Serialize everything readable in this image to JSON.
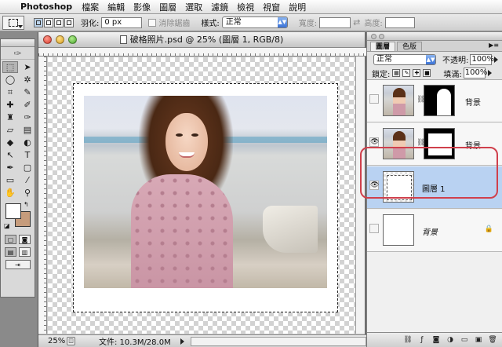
{
  "menubar": {
    "app_name": "Photoshop",
    "items": [
      "檔案",
      "編輯",
      "影像",
      "圖層",
      "選取",
      "濾鏡",
      "檢視",
      "視窗",
      "說明"
    ]
  },
  "options": {
    "feather_label": "羽化:",
    "feather_value": "0 px",
    "antialias_label": "消除鋸齒",
    "style_label": "樣式:",
    "style_value": "正常",
    "width_label": "寬度:",
    "height_label": "高度:",
    "width_value": "",
    "height_value": ""
  },
  "toolbox": {
    "tools": [
      {
        "name": "marquee-tool-icon",
        "glyph": "⬚"
      },
      {
        "name": "move-tool-icon",
        "glyph": "➤"
      },
      {
        "name": "lasso-tool-icon",
        "glyph": "◯"
      },
      {
        "name": "magic-wand-tool-icon",
        "glyph": "✲"
      },
      {
        "name": "crop-tool-icon",
        "glyph": "⌗"
      },
      {
        "name": "slice-tool-icon",
        "glyph": "✎"
      },
      {
        "name": "healing-brush-icon",
        "glyph": "✚"
      },
      {
        "name": "brush-tool-icon",
        "glyph": "✐"
      },
      {
        "name": "stamp-tool-icon",
        "glyph": "♜"
      },
      {
        "name": "history-brush-icon",
        "glyph": "✑"
      },
      {
        "name": "eraser-tool-icon",
        "glyph": "▱"
      },
      {
        "name": "gradient-tool-icon",
        "glyph": "▤"
      },
      {
        "name": "blur-tool-icon",
        "glyph": "◆"
      },
      {
        "name": "dodge-tool-icon",
        "glyph": "◐"
      },
      {
        "name": "path-selection-icon",
        "glyph": "↖"
      },
      {
        "name": "type-tool-icon",
        "glyph": "T"
      },
      {
        "name": "pen-tool-icon",
        "glyph": "✒"
      },
      {
        "name": "shape-tool-icon",
        "glyph": "▢"
      },
      {
        "name": "notes-tool-icon",
        "glyph": "▭"
      },
      {
        "name": "eyedropper-tool-icon",
        "glyph": "⁄"
      },
      {
        "name": "hand-tool-icon",
        "glyph": "✋"
      },
      {
        "name": "zoom-tool-icon",
        "glyph": "⚲"
      }
    ],
    "fg_color": "#ffffff",
    "bg_color": "#c69c7c"
  },
  "document": {
    "title": "破格照片.psd @ 25% (圖層 1, RGB/8)",
    "zoom": "25%",
    "file_info": "文件: 10.3M/28.0M"
  },
  "layers": {
    "tab_layers": "圖層",
    "tab_channels": "色版",
    "blend_mode": "正常",
    "opacity_label": "不透明:",
    "opacity_value": "100%",
    "lock_label": "鎖定:",
    "fill_label": "填滿:",
    "fill_value": "100%",
    "rows": [
      {
        "name": "背景",
        "visible": false
      },
      {
        "name": "背景",
        "visible": true
      },
      {
        "name": "圖層 1",
        "visible": true,
        "selected": true
      },
      {
        "name": "背景",
        "visible": false,
        "locked": true
      }
    ]
  },
  "colors": {
    "highlight": "#d0404c",
    "selected_layer": "#b9d2f2"
  }
}
